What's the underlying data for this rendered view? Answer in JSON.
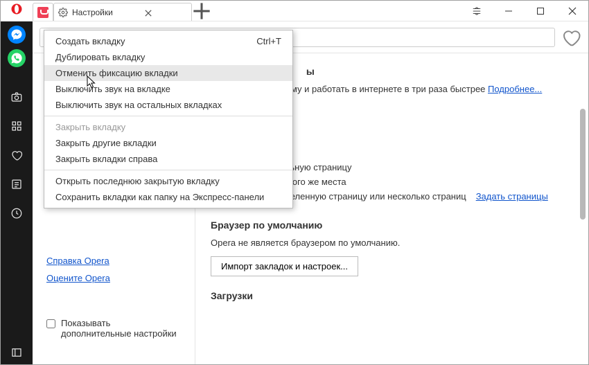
{
  "tab": {
    "title": "Настройки"
  },
  "context_menu": {
    "items": [
      {
        "label": "Создать вкладку",
        "shortcut": "Ctrl+T"
      },
      {
        "label": "Дублировать вкладку"
      },
      {
        "label": "Отменить фиксацию вкладки",
        "hover": true
      },
      {
        "label": "Выключить звук на вкладке"
      },
      {
        "label": "Выключить звук на остальных вкладках"
      }
    ],
    "items2": [
      {
        "label": "Закрыть вкладку",
        "disabled": true
      },
      {
        "label": "Закрыть другие вкладки"
      },
      {
        "label": "Закрыть вкладки справа"
      }
    ],
    "items3": [
      {
        "label": "Открыть последнюю закрытую вкладку"
      },
      {
        "label": "Сохранить вкладки как папку на Экспресс-панели"
      }
    ]
  },
  "main": {
    "ad_section_suffix": "ы",
    "ad_text": "ламу и работать в интернете в три раза быстрее ",
    "ad_link": "Подробнее...",
    "radio1": "Открыть начальную страницу",
    "radio2": "Продолжить с того же места",
    "radio3": "Открыть определенную страницу или несколько страниц ",
    "radio3_link": "Задать страницы",
    "default_title": "Браузер по умолчанию",
    "default_text": "Opera не является браузером по умолчанию.",
    "import_btn": "Импорт закладок и настроек...",
    "downloads_title": "Загрузки"
  },
  "sidebar": {
    "help_link": "Справка Opera",
    "rate_link": "Оцените Opera",
    "advanced_label": "Показывать дополнительные настройки"
  }
}
